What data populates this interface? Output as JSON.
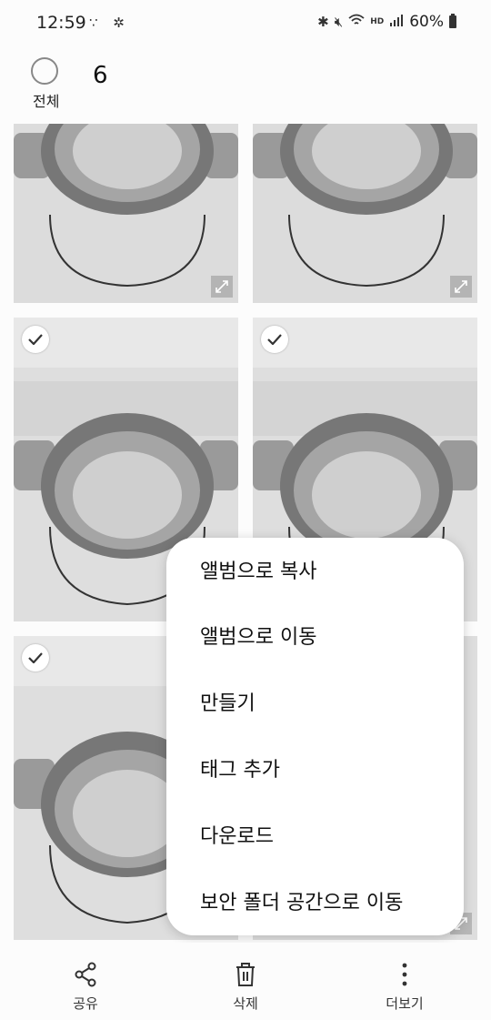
{
  "status_bar": {
    "time": "12:59",
    "left_icons": "∵ ✲",
    "battery_text": "60%",
    "hd_text": "HD"
  },
  "selection": {
    "count": "6",
    "select_all_label": "전체"
  },
  "menu": {
    "items": [
      "앨범으로 복사",
      "앨범으로 이동",
      "만들기",
      "태그 추가",
      "다운로드",
      "보안 폴더 공간으로 이동"
    ]
  },
  "bottom_bar": {
    "share_label": "공유",
    "delete_label": "삭제",
    "more_label": "더보기"
  },
  "colors": {
    "background": "#fcfcfc",
    "menu_bg": "#ffffff",
    "icon": "#333333"
  }
}
